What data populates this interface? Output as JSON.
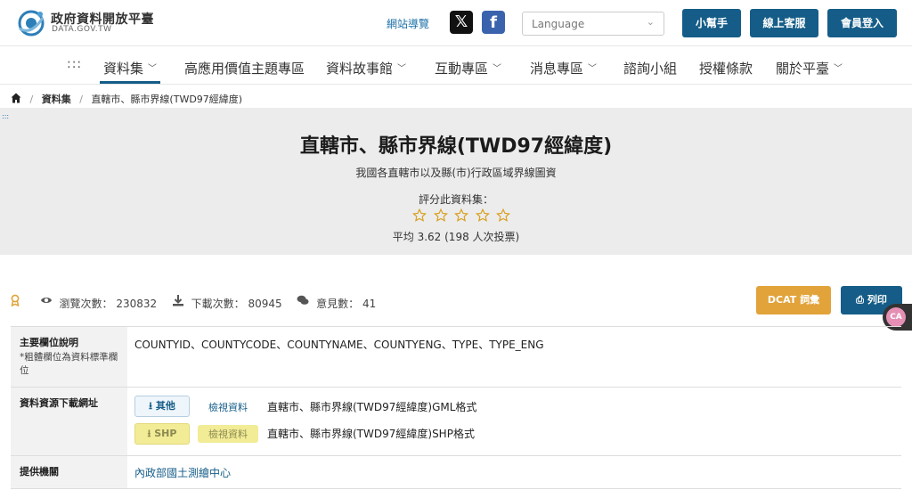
{
  "header": {
    "site_title": "政府資料開放平臺",
    "site_sub": "DATA.GOV.TW",
    "sitemap_label": "網站導覽",
    "x_icon": "x-icon",
    "fb_icon": "facebook-icon",
    "language_placeholder": "Language",
    "buttons": {
      "helper": "小幫手",
      "service": "線上客服",
      "login": "會員登入"
    },
    "colors": {
      "primary": "#155d88",
      "accent": "#e1a33a"
    }
  },
  "nav": {
    "dots": ":::",
    "items": [
      {
        "label": "資料集",
        "has_dropdown": true,
        "active": true
      },
      {
        "label": "高應用價值主題專區",
        "has_dropdown": false
      },
      {
        "label": "資料故事館",
        "has_dropdown": true
      },
      {
        "label": "互動專區",
        "has_dropdown": true
      },
      {
        "label": "消息專區",
        "has_dropdown": true
      },
      {
        "label": "諮詢小組",
        "has_dropdown": false
      },
      {
        "label": "授權條款",
        "has_dropdown": false
      },
      {
        "label": "關於平臺",
        "has_dropdown": true
      }
    ]
  },
  "breadcrumb": {
    "section": "資料集",
    "current": "直轄市、縣市界線(TWD97經緯度)",
    "tiny_dots": ":::"
  },
  "dataset": {
    "title": "直轄市、縣市界線(TWD97經緯度)",
    "description": "我國各直轄市以及縣(市)行政區域界線圖資",
    "rate_prompt": "評分此資料集：",
    "star_count": 5,
    "average_text": "平均 3.62 (198 人次投票)"
  },
  "stats": {
    "views_label": "瀏覽次數：",
    "views": "230832",
    "downloads_label": "下載次數：",
    "downloads": "80945",
    "comments_label": "意見數：",
    "comments": "41"
  },
  "actions": {
    "dcat": "DCAT 詞彙",
    "print": "列印"
  },
  "side_badge": {
    "text": "CA"
  },
  "table": {
    "fields_label": "主要欄位說明",
    "fields_note": "*粗體欄位為資料標準欄位",
    "fields_value": "COUNTYID、COUNTYCODE、COUNTYNAME、COUNTYENG、TYPE、TYPE_ENG",
    "download_label": "資料資源下載網址",
    "resources": [
      {
        "format": "其他",
        "view": "檢視資料",
        "name": "直轄市、縣市界線(TWD97經緯度)GML格式",
        "highlighted": false
      },
      {
        "format": "SHP",
        "view": "檢視資料",
        "name": "直轄市、縣市界線(TWD97經緯度)SHP格式",
        "highlighted": true
      }
    ],
    "agency_label": "提供機關",
    "agency_value": "內政部國土測繪中心"
  }
}
